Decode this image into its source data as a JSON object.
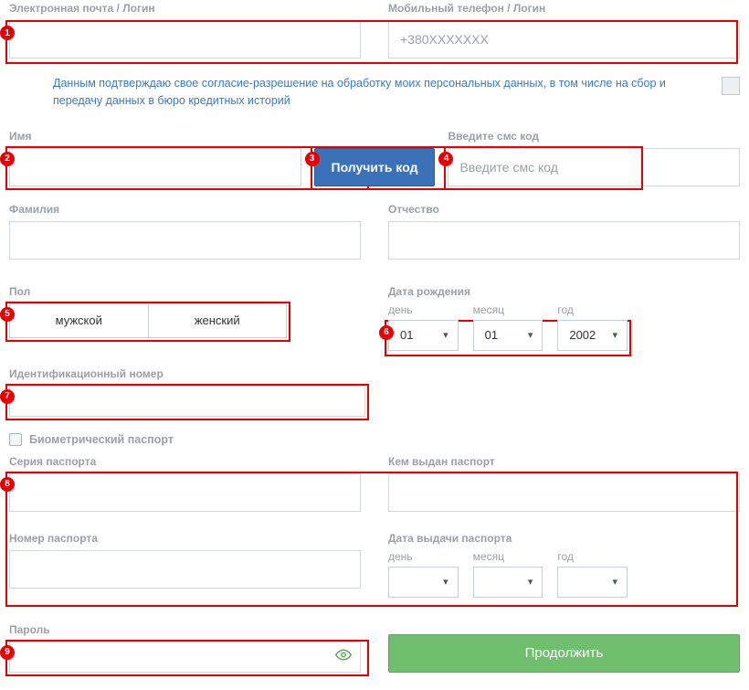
{
  "email": {
    "label": "Электронная почта / Логин"
  },
  "phone": {
    "label": "Мобильный телефон / Логин",
    "placeholder": "+380XXXXXXX"
  },
  "consent": {
    "text": "Данным подтверждаю свое согласие-разрешение на обработку моих персональных данных, в том числе на сбор и передачу данных в бюро кредитных историй"
  },
  "first_name": {
    "label": "Имя"
  },
  "last_name": {
    "label": "Фамилия"
  },
  "patronymic": {
    "label": "Отчество"
  },
  "sms": {
    "button_label": "Получить код",
    "input_label": "Введите смс код",
    "input_placeholder": "Введите смс код"
  },
  "gender": {
    "label": "Пол",
    "male": "мужской",
    "female": "женский"
  },
  "dob": {
    "label": "Дата рождения",
    "day_label": "день",
    "month_label": "месяц",
    "year_label": "год",
    "day": "01",
    "month": "01",
    "year": "2002"
  },
  "id_number": {
    "label": "Идентификационный номер"
  },
  "biometric": {
    "label": "Биометрический паспорт"
  },
  "passport_series": {
    "label": "Серия паспорта"
  },
  "passport_issued_by": {
    "label": "Кем выдан паспорт"
  },
  "passport_number": {
    "label": "Номер паспорта"
  },
  "passport_date": {
    "label": "Дата выдачи паспорта",
    "day_label": "день",
    "month_label": "месяц",
    "year_label": "год",
    "day": "",
    "month": "",
    "year": ""
  },
  "password": {
    "label": "Пароль"
  },
  "submit": {
    "label": "Продолжить"
  },
  "markers": [
    "1",
    "2",
    "3",
    "4",
    "5",
    "6",
    "7",
    "8",
    "9"
  ]
}
